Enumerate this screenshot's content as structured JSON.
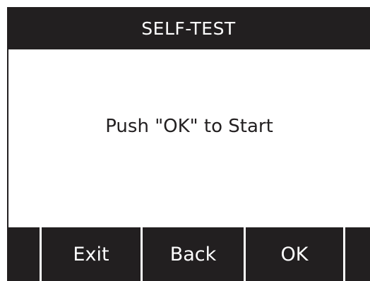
{
  "screen": {
    "title": "SELF-TEST",
    "message": "Push \"OK\" to Start"
  },
  "softkeys": [
    {
      "label": ""
    },
    {
      "label": "Exit"
    },
    {
      "label": "Back"
    },
    {
      "label": "OK"
    },
    {
      "label": ""
    }
  ],
  "colors": {
    "bar_background": "#221f20",
    "bar_text": "#ffffff",
    "content_background": "#ffffff",
    "content_text": "#221f20"
  }
}
